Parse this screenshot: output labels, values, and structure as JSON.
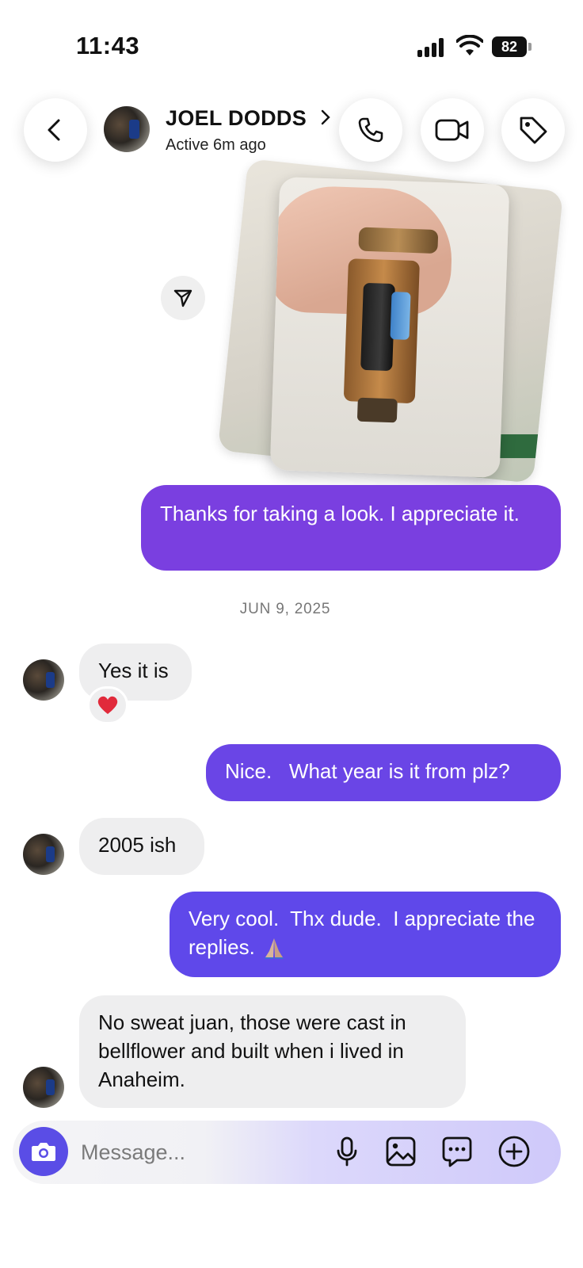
{
  "status_bar": {
    "time": "11:43",
    "battery": "82"
  },
  "header": {
    "name": "JOEL DODDS",
    "status": "Active 6m ago"
  },
  "messages": [
    {
      "side": "outgoing",
      "text": "Thanks for taking a look. I appreciate it."
    },
    {
      "side": "incoming",
      "text": "Yes it is",
      "reaction": "heart"
    },
    {
      "side": "outgoing",
      "text": "Nice.   What year is it from plz?"
    },
    {
      "side": "incoming",
      "text": "2005 ish"
    },
    {
      "side": "outgoing",
      "text": "Very cool.  Thx dude.  I appreciate the replies.",
      "emoji": "folded-hands"
    },
    {
      "side": "incoming",
      "text": "No sweat juan, those were cast in bellflower and built when i lived in Anaheim."
    }
  ],
  "date_separator": "JUN 9, 2025",
  "composer": {
    "placeholder": "Message..."
  },
  "colors": {
    "outgoing_1": "#7a3fe0",
    "outgoing_2": "#6a45e6",
    "outgoing_3": "#5f48ea",
    "incoming": "#eeeeef",
    "camera_button": "#5a4de6"
  },
  "icons": [
    "back-icon",
    "phone-icon",
    "video-icon",
    "tag-icon",
    "share-icon",
    "heart-icon",
    "camera-icon",
    "mic-icon",
    "gallery-icon",
    "sticker-icon",
    "plus-icon"
  ]
}
